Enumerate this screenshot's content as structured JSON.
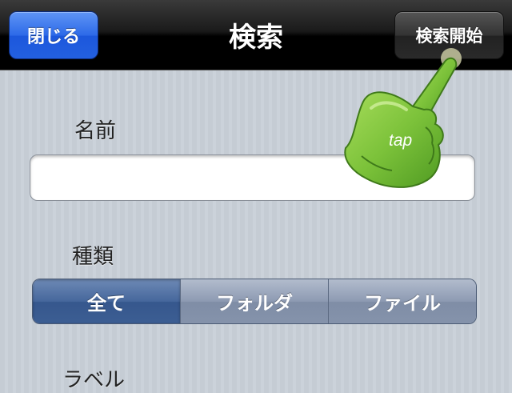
{
  "navbar": {
    "close_label": "閉じる",
    "title": "検索",
    "search_start_label": "検索開始"
  },
  "form": {
    "name_label": "名前",
    "name_value": "",
    "type_label": "種類",
    "type_options": [
      "全て",
      "フォルダ",
      "ファイル"
    ],
    "type_selected": "全て",
    "label_label": "ラベル"
  },
  "hint": {
    "gesture_text": "tap",
    "hand_icon": "pointing-hand-icon",
    "hand_color": "#7cc23a"
  },
  "colors": {
    "close_button": "#2d6ae8",
    "selected_segment": "#46679c"
  }
}
